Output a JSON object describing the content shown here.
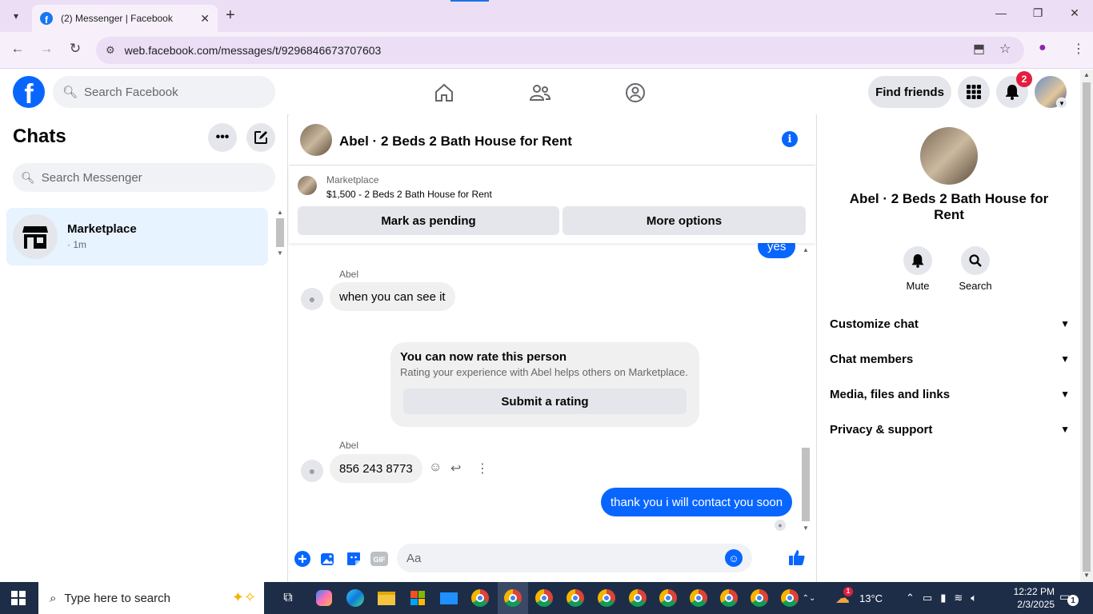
{
  "browser": {
    "tab_title": "(2) Messenger | Facebook",
    "url": "web.facebook.com/messages/t/9296846673707603"
  },
  "fb_header": {
    "logo_letter": "f",
    "search_placeholder": "Search Facebook",
    "find_friends": "Find friends",
    "notification_count": "2"
  },
  "chats": {
    "title": "Chats",
    "search_placeholder": "Search Messenger",
    "items": [
      {
        "name": "Marketplace",
        "time": "· 1m"
      }
    ]
  },
  "conversation": {
    "title": "Abel · 2 Beds 2 Bath House for Rent",
    "listing_source": "Marketplace",
    "listing_price": "$1,500 - 2 Beds 2 Bath House for Rent",
    "mark_pending": "Mark as pending",
    "more_options": "More options",
    "messages": [
      {
        "from": "me",
        "text": "yes"
      },
      {
        "sender": "Abel",
        "text": "when you can see it"
      },
      {
        "sender": "Abel",
        "text": "856 243 8773"
      },
      {
        "from": "me",
        "text": "thank you i will contact you soon"
      }
    ],
    "rating": {
      "title": "You can now rate this person",
      "subtitle": "Rating your experience with Abel helps others on Marketplace.",
      "button": "Submit a rating"
    },
    "composer_placeholder": "Aa"
  },
  "details": {
    "name": "Abel · 2 Beds 2 Bath House for Rent",
    "actions": [
      "Mute",
      "Search"
    ],
    "sections": [
      "Customize chat",
      "Chat members",
      "Media, files and links",
      "Privacy & support"
    ]
  },
  "taskbar": {
    "search_placeholder": "Type here to search",
    "weather": "13°C",
    "weather_badge": "1",
    "time": "12:22 PM",
    "date": "2/3/2025",
    "notification_count": "1"
  },
  "colors": {
    "fb_blue": "#0866ff",
    "selected_chat": "#e7f3ff",
    "badge_red": "#e41e3f",
    "tabstrip": "#ecdff5"
  }
}
